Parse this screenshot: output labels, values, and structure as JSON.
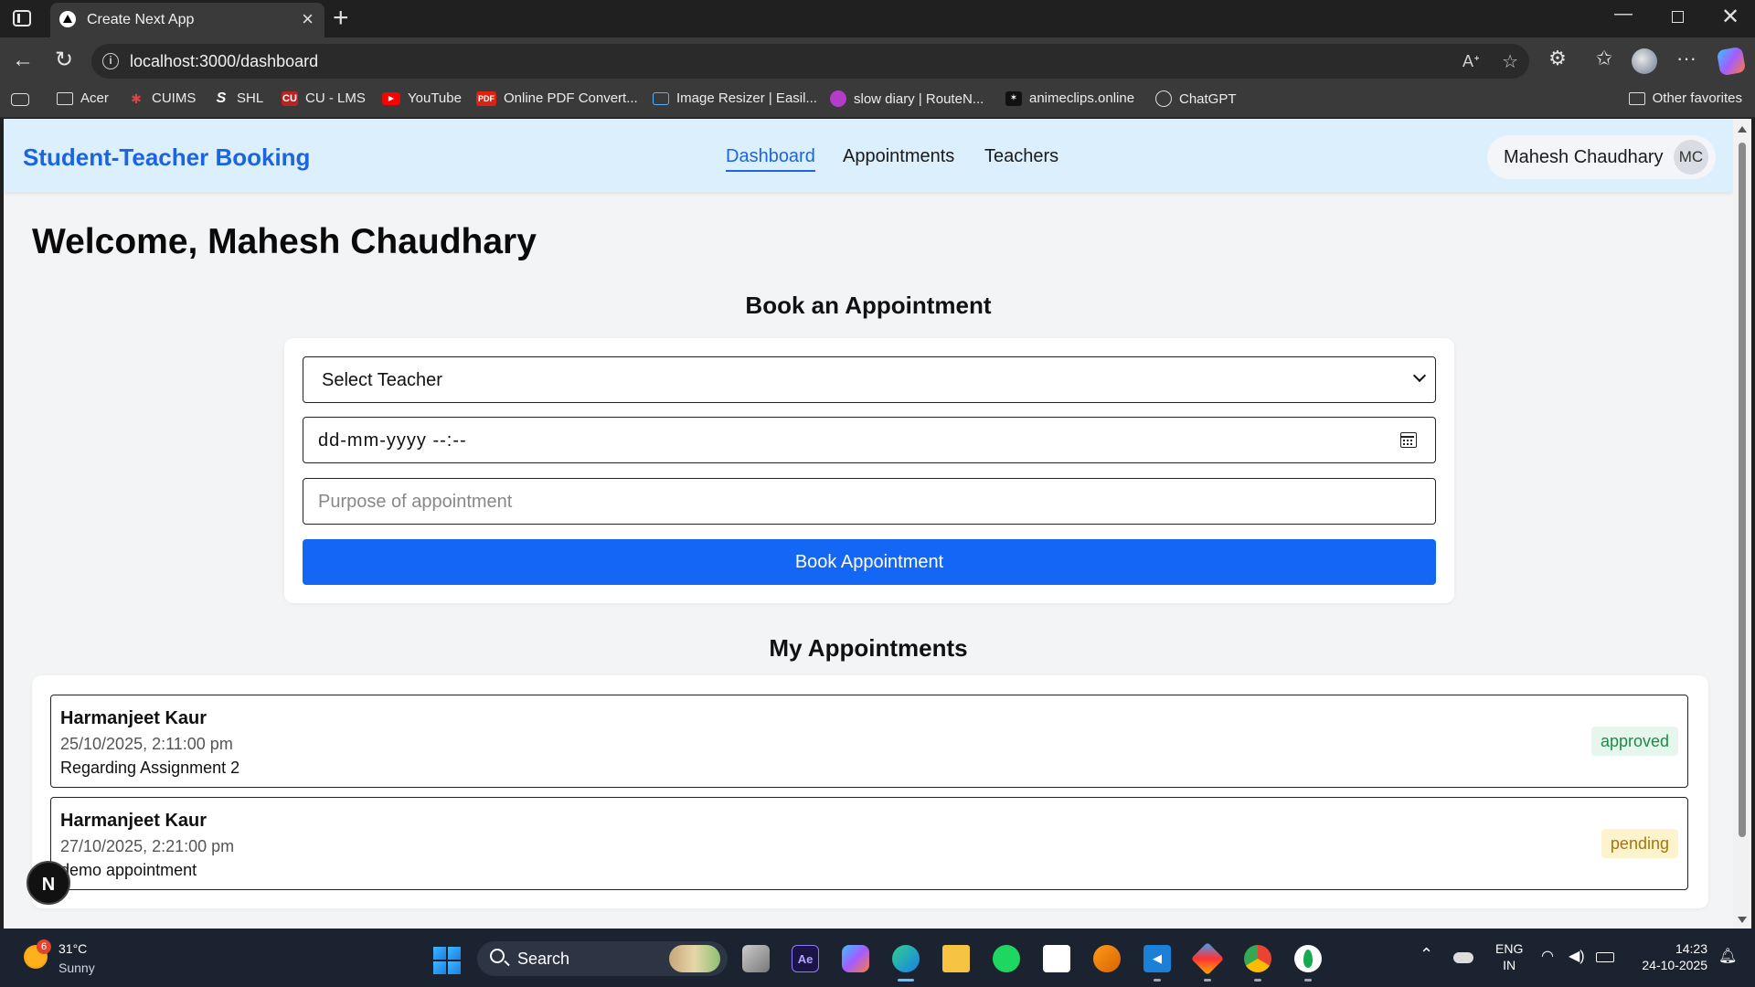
{
  "browser": {
    "tab_title": "Create Next App",
    "url": "localhost:3000/dashboard",
    "bookmarks": [
      {
        "label": "Acer",
        "icon": "folder-icon"
      },
      {
        "label": "CUIMS",
        "icon": "cuims-icon"
      },
      {
        "label": "SHL",
        "icon": "shl-icon"
      },
      {
        "label": "CU - LMS",
        "icon": "cu-lms-icon"
      },
      {
        "label": "YouTube",
        "icon": "youtube-icon"
      },
      {
        "label": "Online PDF Convert...",
        "icon": "pdf-icon"
      },
      {
        "label": "Image Resizer | Easil...",
        "icon": "image-resizer-icon"
      },
      {
        "label": "slow diary | RouteN...",
        "icon": "slow-diary-icon"
      },
      {
        "label": "animeclips.online",
        "icon": "animeclips-icon"
      },
      {
        "label": "ChatGPT",
        "icon": "chatgpt-icon"
      }
    ],
    "other_favorites": "Other favorites",
    "icon_glyphs": {
      "pdf": "PDF",
      "shl": "S",
      "cuims": "✱",
      "culms": "CU",
      "youtube": "▶",
      "anime": "✶"
    }
  },
  "app": {
    "brand": "Student-Teacher Booking",
    "nav": {
      "dashboard": "Dashboard",
      "appointments": "Appointments",
      "teachers": "Teachers"
    },
    "user": {
      "name": "Mahesh Chaudhary",
      "initials": "MC"
    },
    "welcome": "Welcome, Mahesh Chaudhary",
    "booking": {
      "title": "Book an Appointment",
      "teacher_select": "Select Teacher",
      "datetime_value": "dd-mm-yyyy --:--",
      "purpose_placeholder": "Purpose of appointment",
      "submit_label": "Book Appointment"
    },
    "appointments": {
      "title": "My Appointments",
      "items": [
        {
          "teacher": "Harmanjeet Kaur",
          "datetime": "25/10/2025, 2:11:00 pm",
          "purpose": "Regarding Assignment 2",
          "status": "approved"
        },
        {
          "teacher": "Harmanjeet Kaur",
          "datetime": "27/10/2025, 2:21:00 pm",
          "purpose": "demo appointment",
          "status": "pending"
        }
      ]
    },
    "next_badge": "N"
  },
  "taskbar": {
    "weather": {
      "temp": "31°C",
      "desc": "Sunny",
      "badge": "6"
    },
    "search_label": "Search",
    "lang": {
      "line1": "ENG",
      "line2": "IN"
    },
    "time": "14:23",
    "date": "24-10-2025",
    "app_glyphs": {
      "ae": "Ae",
      "vscode": "◀"
    }
  },
  "colors": {
    "brand_blue": "#1d64e0",
    "button_blue": "#1466f5",
    "header_bg": "#dbeffd",
    "approved_bg": "#e6f6ec",
    "approved_text": "#1d8a4b",
    "pending_bg": "#fdf3cd",
    "pending_text": "#a4760a"
  }
}
